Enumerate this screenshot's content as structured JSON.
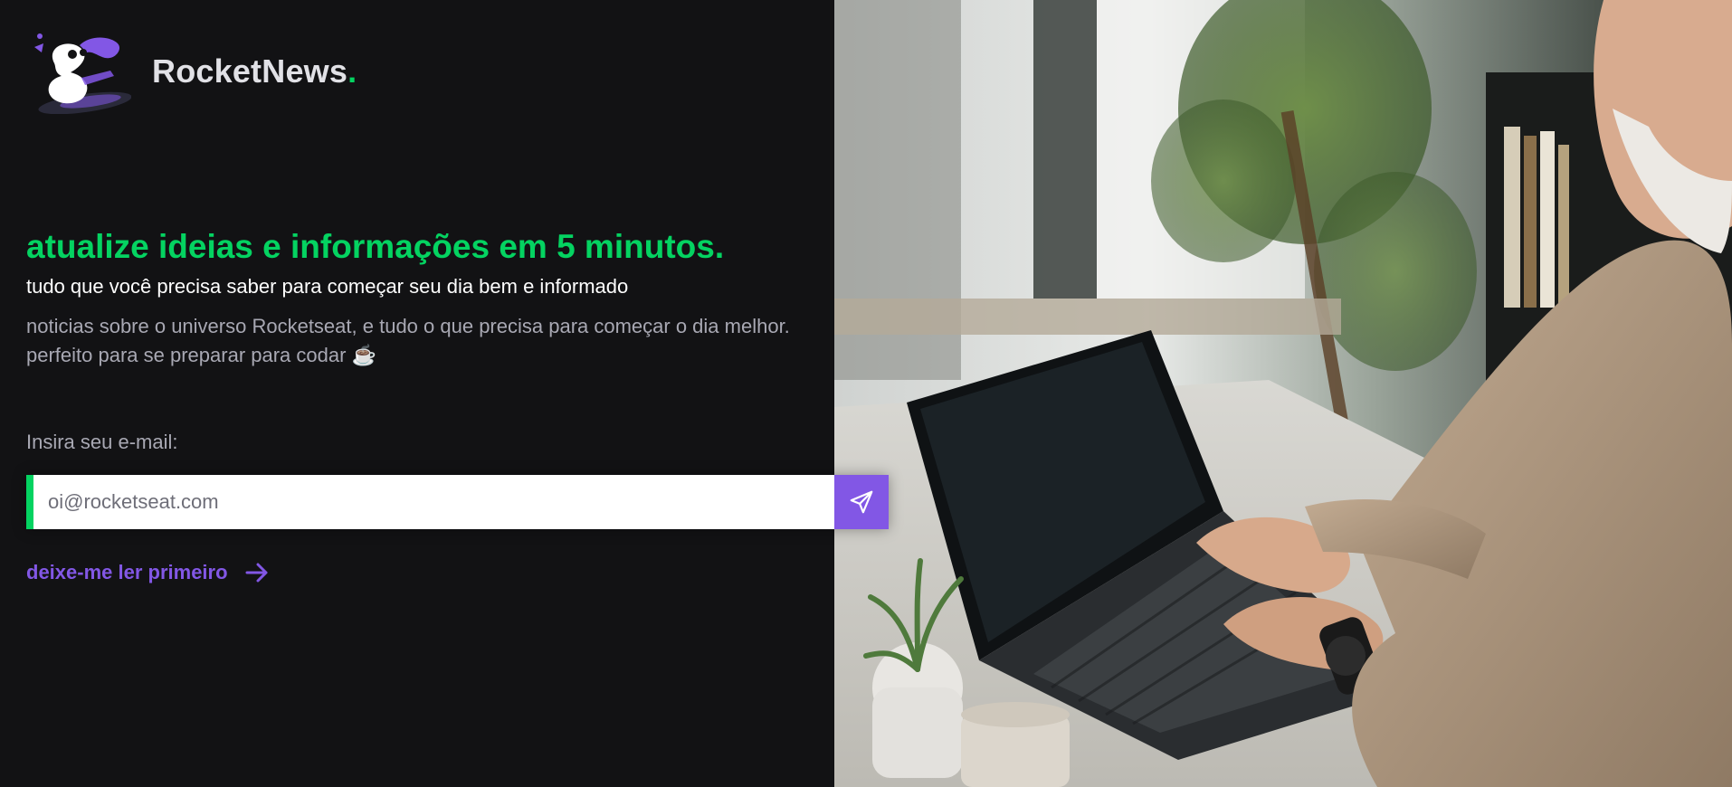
{
  "brand": {
    "name": "RocketNews",
    "dot": "."
  },
  "hero": {
    "headline": "atualize ideias e informações em 5 minutos.",
    "subheadline": "tudo que você precisa saber para começar seu dia bem e informado",
    "description": "noticias sobre o universo Rocketseat, e tudo o que precisa para começar o dia melhor. perfeito para se preparar para codar ☕"
  },
  "form": {
    "label": "Insira seu e-mail:",
    "placeholder": "oi@rocketseat.com",
    "send_icon": "paper-plane-icon"
  },
  "link": {
    "label": "deixe-me ler primeiro",
    "icon": "arrow-right-icon"
  },
  "colors": {
    "background": "#121214",
    "accent_green": "#04d361",
    "accent_purple": "#8257e5",
    "text_muted": "#a8a8b3"
  }
}
